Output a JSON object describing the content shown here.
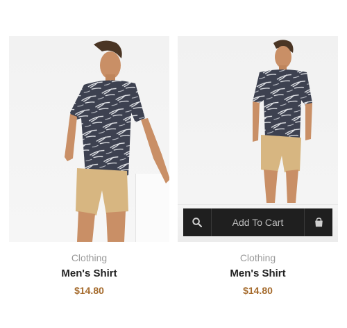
{
  "products": [
    {
      "category": "Clothing",
      "title": "Men's Shirt",
      "price": "$14.80"
    },
    {
      "category": "Clothing",
      "title": "Men's Shirt",
      "price": "$14.80",
      "actions": {
        "quick_view_icon": "search-icon",
        "add_to_cart_label": "Add To Cart",
        "cart_icon": "shopping-bag-icon"
      }
    }
  ]
}
